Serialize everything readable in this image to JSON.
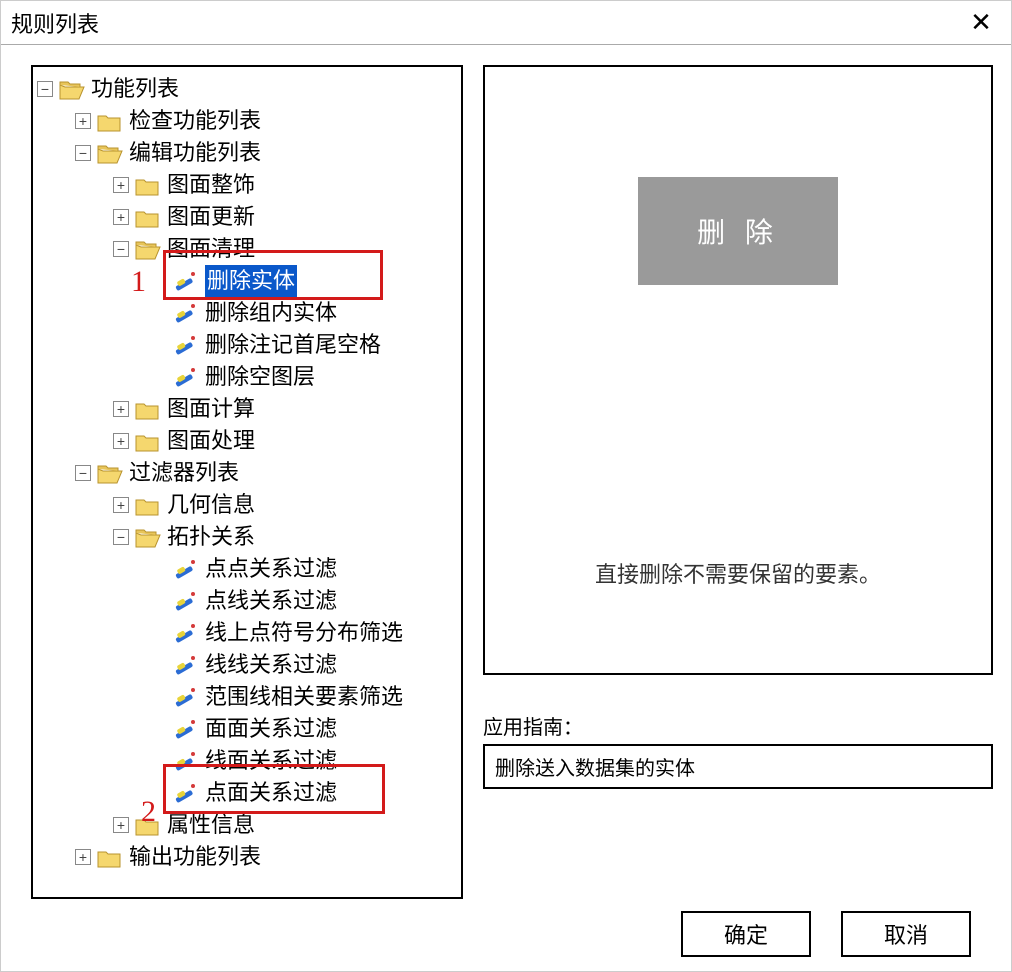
{
  "title": "规则列表",
  "tree": {
    "root": "功能列表",
    "check": "检查功能列表",
    "edit": "编辑功能列表",
    "deco": "图面整饰",
    "update": "图面更新",
    "clean": "图面清理",
    "del_entity": "删除实体",
    "del_group": "删除组内实体",
    "del_space": "删除注记首尾空格",
    "del_layer": "删除空图层",
    "calc": "图面计算",
    "proc": "图面处理",
    "filter": "过滤器列表",
    "geom": "几何信息",
    "topo": "拓扑关系",
    "pp": "点点关系过滤",
    "pl": "点线关系过滤",
    "lps": "线上点符号分布筛选",
    "ll": "线线关系过滤",
    "range": "范围线相关要素筛选",
    "aa": "面面关系过滤",
    "la": "线面关系过滤",
    "pa": "点面关系过滤",
    "attr": "属性信息",
    "output": "输出功能列表"
  },
  "action_button": "删 除",
  "preview_desc": "直接删除不需要保留的要素。",
  "guide_label": "应用指南：",
  "guide_text": "删除送入数据集的实体",
  "ok": "确定",
  "cancel": "取消",
  "annot1": "1",
  "annot2": "2"
}
